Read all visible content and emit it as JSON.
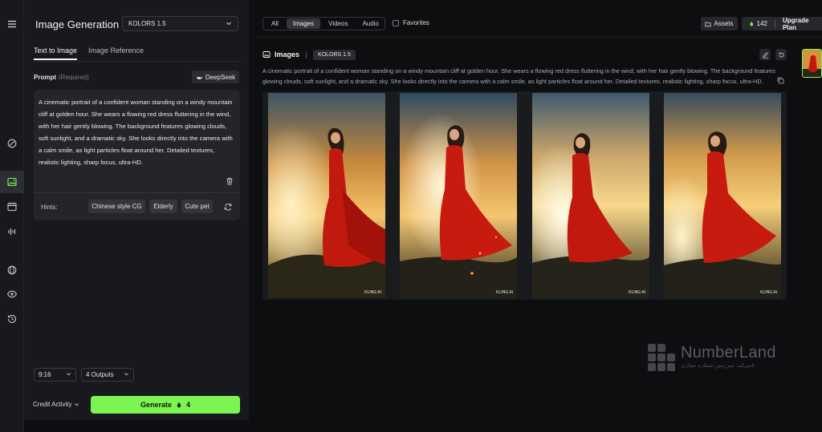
{
  "rail": {
    "items": [
      {
        "icon": "menu-icon"
      },
      {
        "icon": "palette-icon"
      },
      {
        "icon": "image-icon",
        "active": true
      },
      {
        "icon": "video-icon"
      },
      {
        "icon": "audio-icon"
      },
      {
        "icon": "sphere-icon"
      },
      {
        "icon": "eye-icon"
      },
      {
        "icon": "history-icon"
      }
    ]
  },
  "panel": {
    "title": "Image Generation",
    "model": "KOLORS 1.5",
    "tabs": [
      "Text to Image",
      "Image Reference"
    ],
    "prompt_label": "Prompt",
    "prompt_required": "(Required)",
    "deepseek_label": "DeepSeek",
    "prompt_text": "A cinematic portrait of a confident woman standing on a windy mountain cliff at golden hour. She wears a flowing red dress fluttering in the wind, with her hair gently blowing. The background features glowing clouds, soft sunlight, and a dramatic sky. She looks directly into the camera with a calm smile, as light particles float around her. Detailed textures, realistic lighting, sharp focus, ultra-HD.",
    "hints_label": "Hints:",
    "hints": [
      "Chinese style CG",
      "Elderly",
      "Cute pet"
    ],
    "aspect_ratio": "9:16",
    "outputs": "4 Outputs",
    "credit_activity": "Credit Activity",
    "generate_label": "Generate",
    "generate_cost": "4"
  },
  "topbar": {
    "filters": [
      "All",
      "Images",
      "Videos",
      "Audio"
    ],
    "active_filter": "Images",
    "favorites_label": "Favorites",
    "assets_label": "Assets",
    "credits": "142",
    "upgrade_label": "Upgrade Plan"
  },
  "result": {
    "title": "Images",
    "model_badge": "KOLORS 1.5",
    "prompt_text": "A cinematic portrait of a confident woman standing on a windy mountain cliff at golden hour. She wears a flowing red dress fluttering in the wind, with her hair gently blowing. The background features glowing clouds, soft sunlight, and a dramatic sky. She looks directly into the camera with a calm smile, as light particles float around her. Detailed textures, realistic lighting, sharp focus, ultra-HD.",
    "images": [
      {
        "watermark": "KLING AI"
      },
      {
        "watermark": "KLING AI"
      },
      {
        "watermark": "KLING AI"
      },
      {
        "watermark": "KLING AI"
      }
    ]
  },
  "watermark": {
    "brand": "NumberLand",
    "tagline": "نامبرلند؛ سرزمین شماره مجازی"
  },
  "colors": {
    "accent": "#7cf552",
    "background": "#0d0e10",
    "panel": "#18191c"
  }
}
